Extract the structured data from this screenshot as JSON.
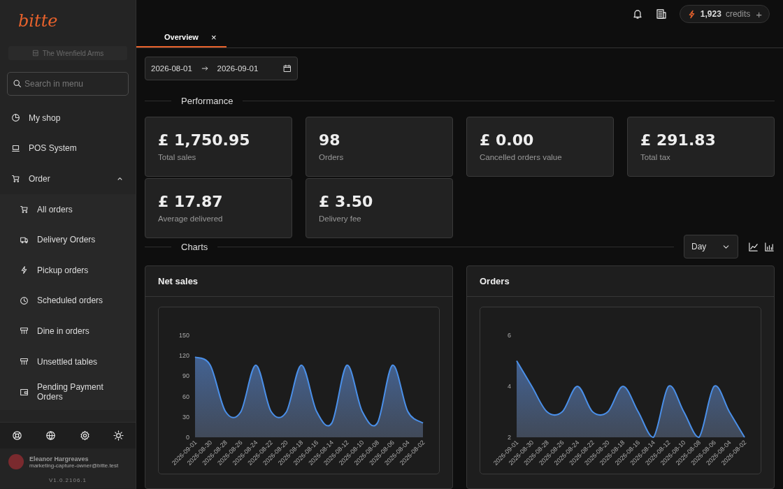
{
  "sidebar": {
    "logo": "bitte",
    "store": "The Wrenfield Arms",
    "search": {
      "placeholder": "Search in menu"
    },
    "items": [
      {
        "label": "My shop"
      },
      {
        "label": "POS System"
      },
      {
        "label": "Order",
        "expanded": true,
        "children": [
          {
            "label": "All orders"
          },
          {
            "label": "Delivery Orders"
          },
          {
            "label": "Pickup orders"
          },
          {
            "label": "Scheduled orders"
          },
          {
            "label": "Dine in orders"
          },
          {
            "label": "Unsettled tables"
          },
          {
            "label": "Pending Payment Orders"
          }
        ]
      }
    ],
    "user": {
      "name": "Eleanor Hargreaves",
      "email": "marketing-capture-owner@bitte.test"
    },
    "version": "V1.0.2106.1"
  },
  "topbar": {
    "credits": {
      "amount": "1,923",
      "label": "credits",
      "add": "+"
    }
  },
  "tabs": [
    {
      "label": "Overview",
      "selected": true,
      "close": "×"
    }
  ],
  "date_range": {
    "start": "2026-08-01",
    "end": "2026-09-01"
  },
  "performance": {
    "title": "Performance",
    "stats": [
      {
        "value": "£ 1,750.95",
        "label": "Total sales"
      },
      {
        "value": "98",
        "label": "Orders"
      },
      {
        "value": "£ 0.00",
        "label": "Cancelled orders value"
      },
      {
        "value": "£ 291.83",
        "label": "Total tax"
      },
      {
        "value": "£ 17.87",
        "label": "Average delivered"
      },
      {
        "value": "£ 3.50",
        "label": "Delivery fee"
      }
    ]
  },
  "charts": {
    "title": "Charts",
    "period": "Day",
    "panels": [
      {
        "title": "Net sales",
        "chart_data": {
          "type": "area",
          "categories": [
            "2026-09-01",
            "2026-08-30",
            "2026-08-28",
            "2026-08-26",
            "2026-08-24",
            "2026-08-22",
            "2026-08-20",
            "2026-08-18",
            "2026-08-16",
            "2026-08-14",
            "2026-08-12",
            "2026-08-10",
            "2026-08-08",
            "2026-08-06",
            "2026-08-04",
            "2026-08-02"
          ],
          "series": [
            {
              "color": "#4a8fe8",
              "values": [
                118,
                106,
                38,
                37,
                106,
                38,
                37,
                106,
                38,
                21,
                106,
                38,
                21,
                106,
                38,
                21
              ]
            }
          ],
          "ylim": [
            0,
            150
          ],
          "yticks": [
            0,
            30,
            60,
            90,
            120,
            150
          ]
        }
      },
      {
        "title": "Orders",
        "chart_data": {
          "type": "area",
          "categories": [
            "2026-09-01",
            "2026-08-30",
            "2026-08-28",
            "2026-08-26",
            "2026-08-24",
            "2026-08-22",
            "2026-08-20",
            "2026-08-18",
            "2026-08-16",
            "2026-08-14",
            "2026-08-12",
            "2026-08-10",
            "2026-08-08",
            "2026-08-06",
            "2026-08-04",
            "2026-08-02"
          ],
          "series": [
            {
              "color": "#4a8fe8",
              "values": [
                5,
                4,
                3,
                3,
                4,
                3,
                3,
                4,
                3,
                2,
                4,
                3,
                2,
                4,
                3,
                2
              ]
            }
          ],
          "ylim": [
            2,
            6
          ],
          "yticks": [
            2,
            4,
            6
          ]
        }
      }
    ]
  }
}
